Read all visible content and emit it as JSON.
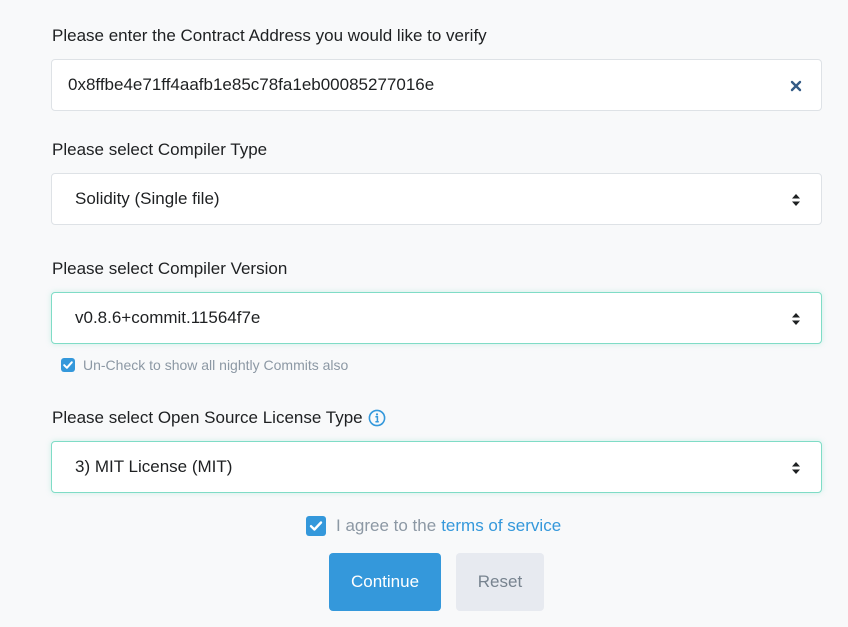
{
  "contract": {
    "label": "Please enter the Contract Address you would like to verify",
    "value": "0x8ffbe4e71ff4aafb1e85c78fa1eb00085277016e",
    "clear_icon": "close-icon"
  },
  "compiler_type": {
    "label": "Please select Compiler Type",
    "selected": "Solidity (Single file)"
  },
  "compiler_version": {
    "label": "Please select Compiler Version",
    "selected": "v0.8.6+commit.11564f7e",
    "nightly_checkbox_label": "Un-Check to show all nightly Commits also",
    "nightly_checked": true
  },
  "license": {
    "label": "Please select Open Source License Type",
    "selected": "3) MIT License (MIT)",
    "info_icon": "info-icon"
  },
  "agree": {
    "text": "I agree to the",
    "link": "terms of service",
    "checked": true
  },
  "buttons": {
    "continue": "Continue",
    "reset": "Reset"
  },
  "colors": {
    "accent": "#3498db",
    "focus_border": "#7fdcc6",
    "muted_text": "#8c98a4",
    "background": "#f8f9fa"
  }
}
